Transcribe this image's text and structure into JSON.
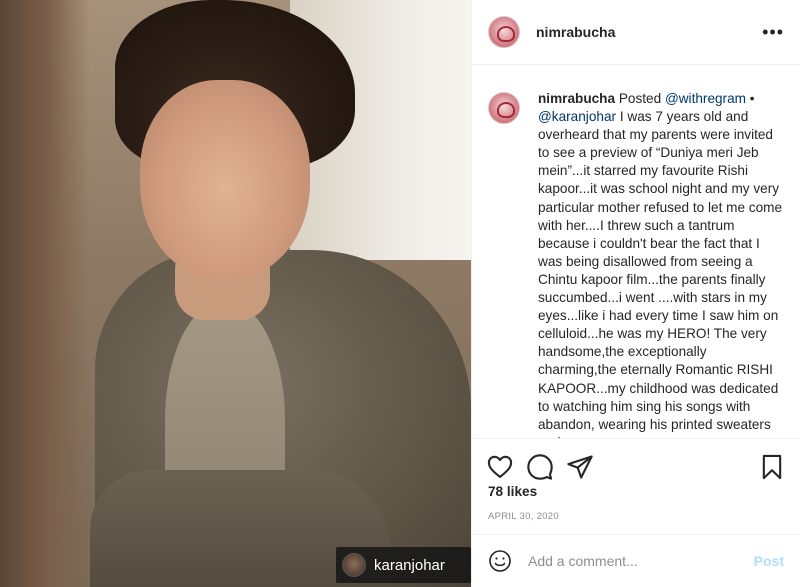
{
  "post": {
    "username": "nimrabucha",
    "credit_tag": "karanjohar"
  },
  "caption": {
    "username": "nimrabucha",
    "posted_text": " Posted ",
    "mention_withregram": "@withregram",
    "bullet": " • ",
    "mention_karanjohar": "@karanjohar",
    "body": " I was 7 years old and overheard that my parents were invited to see a preview of “Duniya meri Jeb mein”...it starred my favourite Rishi kapoor...it was school night and my very particular mother refused to let me come with her....I threw such a tantrum because i couldn't bear the fact that I was being disallowed from seeing a Chintu kapoor film...the parents finally succumbed...i went ....with stars in my eyes...like i had every time I saw him on celluloid...he was my HERO! The very handsome,the exceptionally charming,the eternally Romantic RISHI KAPOOR...my childhood was dedicated to watching him sing his songs with abandon, wearing his printed sweaters and"
  },
  "stats": {
    "likes": "78 likes",
    "date": "APRIL 30, 2020"
  },
  "comment_input": {
    "placeholder": "Add a comment...",
    "post_label": "Post"
  },
  "icons": {
    "more": "more-options-icon",
    "like": "heart-icon",
    "comment": "comment-icon",
    "share": "paper-plane-icon",
    "save": "bookmark-icon",
    "emoji": "emoji-icon"
  },
  "colors": {
    "mention": "#00376b",
    "post_button_disabled": "#b2dffc",
    "muted": "#8e8e8e",
    "text": "#262626"
  }
}
